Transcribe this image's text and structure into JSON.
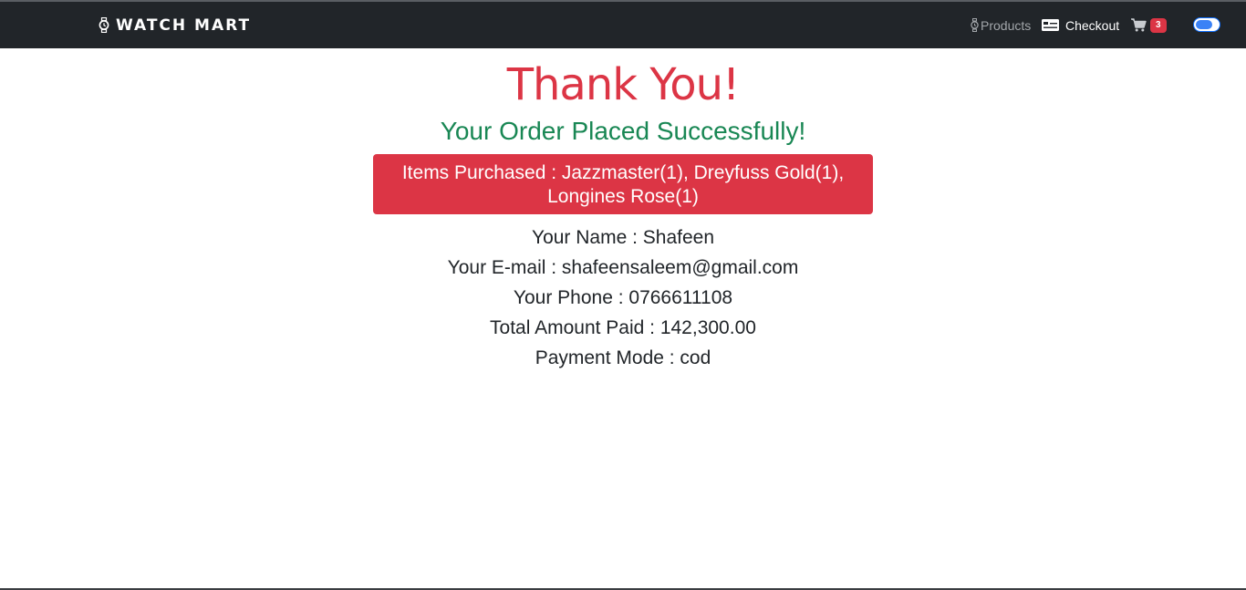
{
  "navbar": {
    "brand": "WATCH MART",
    "brand_icon": "watch-icon",
    "products_label": "Products",
    "products_icon": "watch-icon",
    "checkout_label": "Checkout",
    "checkout_icon": "credit-card-icon",
    "cart_icon": "cart-icon",
    "cart_count": "3",
    "theme_toggle": "dark-mode-toggle"
  },
  "main": {
    "heading": "Thank You!",
    "subheading": "Your Order Placed Successfully!",
    "items_purchased": "Items Purchased : Jazzmaster(1), Dreyfuss Gold(1), Longines Rose(1)",
    "name_line": "Your Name : Shafeen",
    "email_line": "Your E-mail : shafeensaleem@gmail.com",
    "phone_line": "Your Phone : 0766611108",
    "total_line": "Total Amount Paid : 142,300.00",
    "payment_line": "Payment Mode : cod"
  },
  "colors": {
    "navbar_bg": "#212529",
    "heading": "#dc3545",
    "subheading": "#198754",
    "items_box": "#dc3545",
    "badge": "#dc3545",
    "toggle": "#0d6efd"
  }
}
